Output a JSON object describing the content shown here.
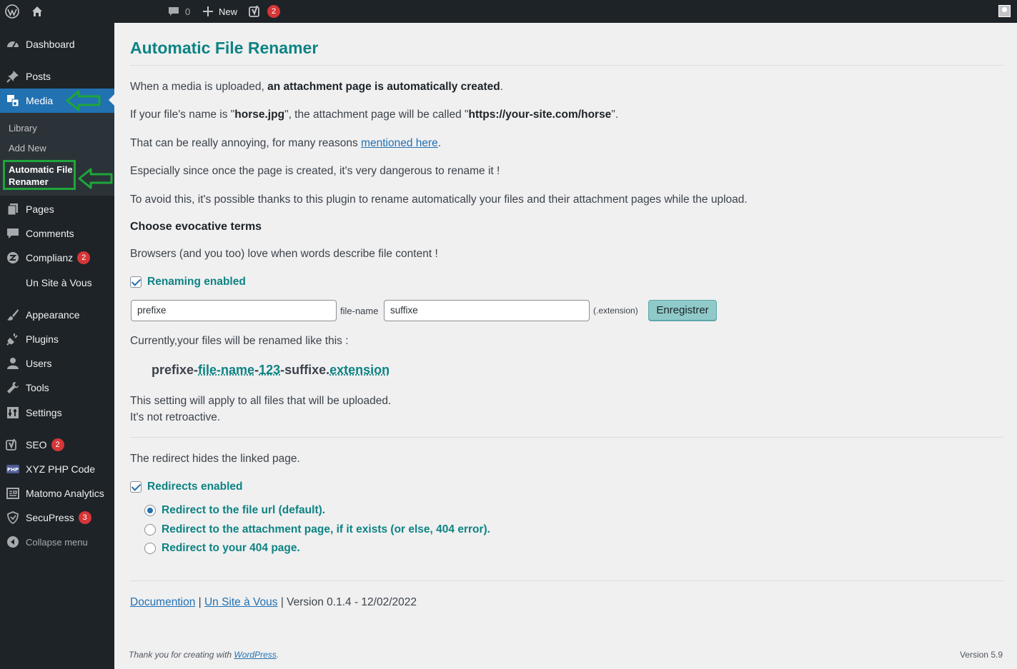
{
  "adminbar": {
    "comments_count": "0",
    "new_label": "New",
    "yoast_badge": "2",
    "icons": [
      "wordpress-logo-icon",
      "home-icon",
      "comment-icon",
      "plus-icon",
      "yoast-icon",
      "user-avatar-icon"
    ]
  },
  "sidebar": {
    "items": [
      {
        "label": "Dashboard",
        "icon": "dashboard-icon"
      },
      {
        "label": "Posts",
        "icon": "pin-icon"
      },
      {
        "label": "Media",
        "icon": "media-icon"
      },
      {
        "label": "Pages",
        "icon": "pages-icon"
      },
      {
        "label": "Comments",
        "icon": "comment-icon"
      },
      {
        "label": "Complianz",
        "icon": "complianz-icon",
        "badge": "2"
      },
      {
        "label": "Un Site à Vous",
        "icon": ""
      },
      {
        "label": "Appearance",
        "icon": "paintbrush-icon"
      },
      {
        "label": "Plugins",
        "icon": "plugin-icon"
      },
      {
        "label": "Users",
        "icon": "users-icon"
      },
      {
        "label": "Tools",
        "icon": "wrench-icon"
      },
      {
        "label": "Settings",
        "icon": "settings-icon"
      },
      {
        "label": "SEO",
        "icon": "yoast-icon",
        "badge": "2"
      },
      {
        "label": "XYZ PHP Code",
        "icon": "php-icon"
      },
      {
        "label": "Matomo Analytics",
        "icon": "analytics-icon"
      },
      {
        "label": "SecuPress",
        "icon": "shield-icon",
        "badge": "3"
      },
      {
        "label": "Collapse menu",
        "icon": "collapse-icon"
      }
    ],
    "submenu": {
      "library": "Library",
      "add_new": "Add New",
      "current": "Automatic File Renamer"
    }
  },
  "main": {
    "title": "Automatic File Renamer",
    "p1_a": "When a media is uploaded, ",
    "p1_b": "an attachment page is automatically created",
    "p1_c": ".",
    "p2_a": "If your file's name is \"",
    "p2_b": "horse.jpg",
    "p2_c": "\", the attachment page will be called \"",
    "p2_d": "https://your-site.com/horse",
    "p2_e": "\".",
    "p3_a": "That can be really annoying, for many reasons ",
    "p3_link": "mentioned here",
    "p3_b": ".",
    "p4": "Especially since once the page is created, it's very dangerous to rename it !",
    "p5": "To avoid this, it's possible thanks to this plugin to rename automatically your files and their attachment pages while the upload.",
    "section_heading": "Choose evocative terms",
    "p6": "Browsers (and you too) love when words describe file content !",
    "renaming_enabled": "Renaming enabled",
    "prefix_value": "prefixe",
    "filename_label": "file-name",
    "suffix_value": "suffixe",
    "extension_label": "(.extension)",
    "save_button": "Enregistrer",
    "currently": "Currently,your files will be renamed like this :",
    "example": {
      "a": "prefixe-",
      "b": "file-name",
      "c": "-",
      "d": "123",
      "e": "-suffixe.",
      "f": "extension"
    },
    "apply_1": "This setting will apply to all files that will be uploaded.",
    "apply_2": "It's not retroactive.",
    "redirect_intro": "The redirect hides the linked page.",
    "redirects_enabled": "Redirects enabled",
    "radio_options": [
      {
        "label": "Redirect to the file url (default).",
        "selected": true
      },
      {
        "label": "Redirect to the attachment page, if it exists (or else, 404 error).",
        "selected": false
      },
      {
        "label": "Redirect to your 404 page.",
        "selected": false
      }
    ],
    "footer": {
      "doc_link": "Documention",
      "sep": " | ",
      "site_link": "Un Site à Vous",
      "version_text": " | Version 0.1.4 - 12/02/2022"
    }
  },
  "wp_footer": {
    "thanks": "Thank you for creating with ",
    "wp_link": "WordPress",
    "dot": ".",
    "version": "Version 5.9"
  },
  "colors": {
    "accent": "#0e8383",
    "sidebar_bg": "#1d2327",
    "active_menu": "#2271b1",
    "annotation_green": "#1fa53a"
  }
}
